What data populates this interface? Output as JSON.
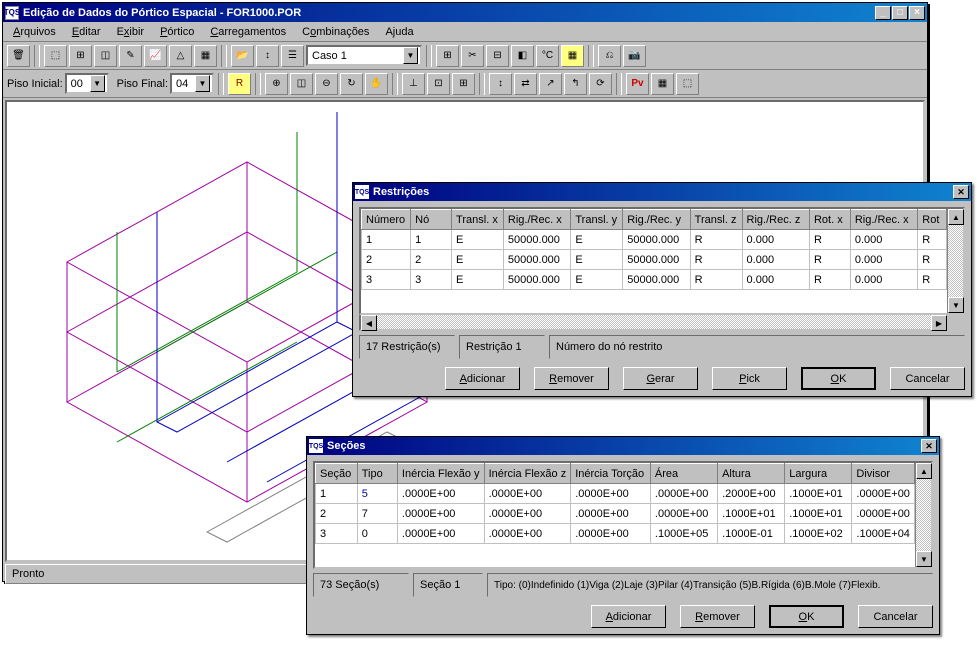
{
  "window": {
    "title": "Edição de Dados do Pórtico Espacial - FOR1000.POR",
    "icon_text": "TQS"
  },
  "menu": {
    "arquivos": "Arquivos",
    "editar": "Editar",
    "exibir": "Exibir",
    "portico": "Pórtico",
    "carregamentos": "Carregamentos",
    "combinacoes": "Combinações",
    "ajuda": "Ajuda"
  },
  "toolbar": {
    "piso_inicial_label": "Piso Inicial:",
    "piso_inicial_value": "00",
    "piso_final_label": "Piso Final:",
    "piso_final_value": "04",
    "caso_label": "Caso 1",
    "r_btn": "R",
    "pv_btn": "Pv"
  },
  "status": {
    "ready": "Pronto"
  },
  "restricoes": {
    "title": "Restrições",
    "headers": {
      "numero": "Número",
      "no": "Nó",
      "tx": "Transl. x",
      "rrx": "Rig./Rec. x",
      "ty": "Transl. y",
      "rry": "Rig./Rec. y",
      "tz": "Transl. z",
      "rrz": "Rig./Rec. z",
      "rx": "Rot. x",
      "rrx2": "Rig./Rec. x",
      "rot": "Rot"
    },
    "rows": [
      {
        "n": "1",
        "no": "1",
        "tx": "E",
        "rrx": "50000.000",
        "ty": "E",
        "rry": "50000.000",
        "tz": "R",
        "rrz": "0.000",
        "rx": "R",
        "rrx2": "0.000",
        "rot": "R"
      },
      {
        "n": "2",
        "no": "2",
        "tx": "E",
        "rrx": "50000.000",
        "ty": "E",
        "rry": "50000.000",
        "tz": "R",
        "rrz": "0.000",
        "rx": "R",
        "rrx2": "0.000",
        "rot": "R"
      },
      {
        "n": "3",
        "no": "3",
        "tx": "E",
        "rrx": "50000.000",
        "ty": "E",
        "rry": "50000.000",
        "tz": "R",
        "rrz": "0.000",
        "rx": "R",
        "rrx2": "0.000",
        "rot": "R"
      }
    ],
    "count": "17 Restrição(s)",
    "current": "Restrição 1",
    "help": "Número do nó restrito",
    "buttons": {
      "adicionar": "Adicionar",
      "remover": "Remover",
      "gerar": "Gerar",
      "pick": "Pick",
      "ok": "OK",
      "cancelar": "Cancelar"
    }
  },
  "secoes": {
    "title": "Seções",
    "headers": {
      "secao": "Seção",
      "tipo": "Tipo",
      "ify": "Inércia Flexão y",
      "ifz": "Inércia Flexão z",
      "it": "Inércia Torção",
      "area": "Área",
      "altura": "Altura",
      "largura": "Largura",
      "divisor": "Divisor"
    },
    "rows": [
      {
        "secao": "1",
        "tipo": "5",
        "ify": ".0000E+00",
        "ifz": ".0000E+00",
        "it": ".0000E+00",
        "area": ".0000E+00",
        "alt": ".2000E+00",
        "larg": ".1000E+01",
        "div": ".0000E+00"
      },
      {
        "secao": "2",
        "tipo": "7",
        "ify": ".0000E+00",
        "ifz": ".0000E+00",
        "it": ".0000E+00",
        "area": ".0000E+00",
        "alt": ".1000E+01",
        "larg": ".1000E+01",
        "div": ".0000E+00"
      },
      {
        "secao": "3",
        "tipo": "0",
        "ify": ".0000E+00",
        "ifz": ".0000E+00",
        "it": ".0000E+00",
        "area": ".1000E+05",
        "alt": ".1000E-01",
        "larg": ".1000E+02",
        "div": ".1000E+04"
      }
    ],
    "count": "73 Seção(s)",
    "current": "Seção 1",
    "help": "Tipo: (0)Indefinido (1)Viga (2)Laje (3)Pilar (4)Transição (5)B.Rígida (6)B.Mole (7)Flexib.",
    "buttons": {
      "adicionar": "Adicionar",
      "remover": "Remover",
      "ok": "OK",
      "cancelar": "Cancelar"
    }
  }
}
